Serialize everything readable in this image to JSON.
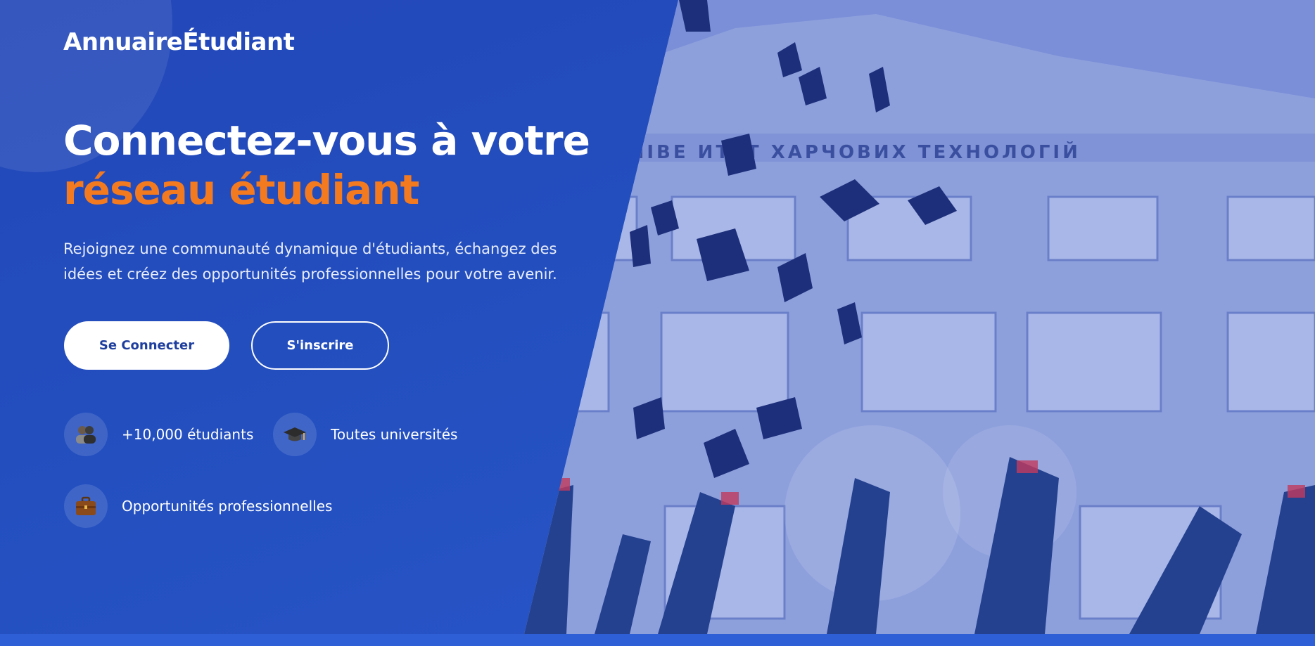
{
  "brand": {
    "name": "AnnuaireÉtudiant"
  },
  "hero": {
    "headline_line1": "Connectez-vous à votre",
    "headline_line2": "réseau étudiant",
    "subtitle": "Rejoignez une communauté dynamique d'étudiants, échangez des idées et créez des opportunités professionnelles pour votre avenir.",
    "buttons": {
      "login": "Se Connecter",
      "signup": "S'inscrire"
    },
    "features": [
      {
        "label": "+10,000 étudiants",
        "icon": "students-icon"
      },
      {
        "label": "Toutes universités",
        "icon": "graduation-cap-icon"
      },
      {
        "label": "Opportunités professionnelles",
        "icon": "briefcase-icon"
      }
    ]
  },
  "colors": {
    "background": "#2651c6",
    "accent": "#f47a1f",
    "button_text": "#1f3f9e"
  }
}
